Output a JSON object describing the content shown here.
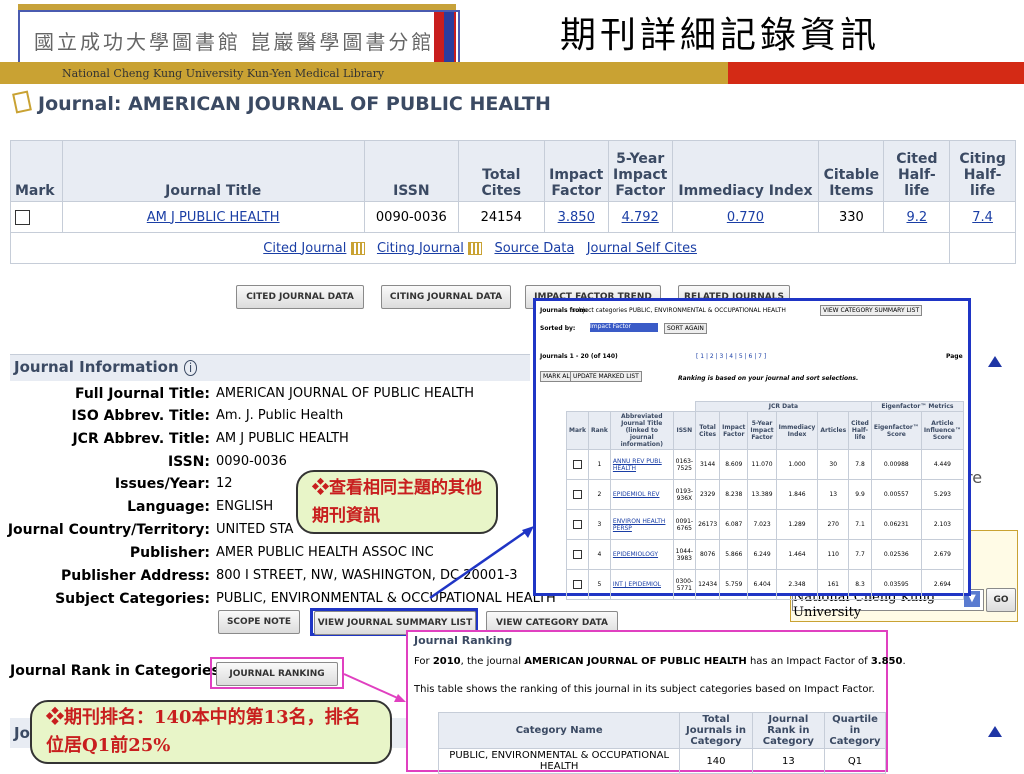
{
  "header": {
    "library_cn": "國立成功大學圖書館 崑巖醫學圖書分館",
    "library_en": "National Cheng Kung University Kun-Yen Medical Library",
    "slide_title": "期刊詳細記錄資訊"
  },
  "journal": {
    "heading": "Journal: AMERICAN JOURNAL OF PUBLIC HEALTH"
  },
  "main_table": {
    "headers": [
      "Mark",
      "Journal Title",
      "ISSN",
      "Total Cites",
      "Impact Factor",
      "5-Year Impact Factor",
      "Immediacy Index",
      "Citable Items",
      "Cited Half-life",
      "Citing Half-life"
    ],
    "row": {
      "title": "AM J PUBLIC HEALTH",
      "issn": "0090-0036",
      "total_cites": "24154",
      "impact_factor": "3.850",
      "five_year_if": "4.792",
      "immediacy": "0.770",
      "citable_items": "330",
      "cited_half_life": "9.2",
      "citing_half_life": "7.4"
    },
    "links": [
      "Cited Journal",
      "Citing Journal",
      "Source Data",
      "Journal Self Cites"
    ]
  },
  "buttons": {
    "cited_journal_data": "CITED JOURNAL DATA",
    "citing_journal_data": "CITING JOURNAL DATA",
    "impact_factor_trend": "IMPACT FACTOR TREND",
    "related_journals": "RELATED JOURNALS",
    "scope_note": "SCOPE NOTE",
    "view_journal_summary": "VIEW JOURNAL SUMMARY LIST",
    "view_category_data": "VIEW CATEGORY DATA",
    "journal_ranking": "JOURNAL RANKING",
    "go": "GO"
  },
  "info": {
    "section_title": "Journal Information",
    "rows": [
      {
        "label": "Full Journal Title:",
        "value": "AMERICAN JOURNAL OF PUBLIC HEALTH"
      },
      {
        "label": "ISO Abbrev. Title:",
        "value": "Am. J. Public Health"
      },
      {
        "label": "JCR Abbrev. Title:",
        "value": "AM J PUBLIC HEALTH"
      },
      {
        "label": "ISSN:",
        "value": "0090-0036"
      },
      {
        "label": "Issues/Year:",
        "value": "12"
      },
      {
        "label": "Language:",
        "value": "ENGLISH"
      },
      {
        "label": "Journal Country/Territory:",
        "value": "UNITED STA"
      },
      {
        "label": "Publisher:",
        "value": "AMER PUBLIC HEALTH ASSOC INC"
      },
      {
        "label": "Publisher Address:",
        "value": "800 I STREET, NW, WASHINGTON, DC 20001-3"
      },
      {
        "label": "Subject Categories:",
        "value": "PUBLIC, ENVIRONMENTAL & OCCUPATIONAL HEALTH"
      }
    ],
    "rank_label": "Journal Rank in Categories:",
    "next_section": "Jo",
    "eigen_fragment": "re",
    "institution_select": "National Cheng Kung University"
  },
  "callouts": {
    "topic": "❖查看相同主題的其他期刊資訊",
    "rank": "❖期刊排名：140本中的第13名，排名位居Q1前25%"
  },
  "overlay_summary": {
    "journals_from_label": "Journals from:",
    "journals_from_value": "subject categories PUBLIC, ENVIRONMENTAL & OCCUPATIONAL HEALTH",
    "view_category_btn": "VIEW CATEGORY SUMMARY LIST",
    "sorted_by_label": "Sorted by:",
    "sorted_by_value": "Impact Factor",
    "sort_again": "SORT AGAIN",
    "count": "Journals 1 - 20 (of 140)",
    "pager": "[ 1 | 2 | 3 | 4 | 5 | 6 | 7 ]",
    "page_label": "Page",
    "mark_all": "MARK ALL",
    "update_marked": "UPDATE MARKED LIST",
    "ranking_note": "Ranking is based on your journal and sort selections.",
    "jcr_group": "JCR Data",
    "eigen_group": "Eigenfactor™ Metrics",
    "headers": [
      "Mark",
      "Rank",
      "Abbreviated Journal Title (linked to journal information)",
      "ISSN",
      "Total Cites",
      "Impact Factor",
      "5-Year Impact Factor",
      "Immediacy Index",
      "Articles",
      "Cited Half-life",
      "Eigenfactor™ Score",
      "Article Influence™ Score"
    ],
    "rows": [
      {
        "rank": "1",
        "title": "ANNU REV PUBL HEALTH",
        "issn": "0163-7525",
        "cites": "3144",
        "if": "8.609",
        "if5": "11.070",
        "imm": "1.000",
        "art": "30",
        "chl": "7.8",
        "eig": "0.00988",
        "ai": "4.449"
      },
      {
        "rank": "2",
        "title": "EPIDEMIOL REV",
        "issn": "0193-936X",
        "cites": "2329",
        "if": "8.238",
        "if5": "13.389",
        "imm": "1.846",
        "art": "13",
        "chl": "9.9",
        "eig": "0.00557",
        "ai": "5.293"
      },
      {
        "rank": "3",
        "title": "ENVIRON HEALTH PERSP",
        "issn": "0091-6765",
        "cites": "26173",
        "if": "6.087",
        "if5": "7.023",
        "imm": "1.289",
        "art": "270",
        "chl": "7.1",
        "eig": "0.06231",
        "ai": "2.103"
      },
      {
        "rank": "4",
        "title": "EPIDEMIOLOGY",
        "issn": "1044-3983",
        "cites": "8076",
        "if": "5.866",
        "if5": "6.249",
        "imm": "1.464",
        "art": "110",
        "chl": "7.7",
        "eig": "0.02536",
        "ai": "2.679"
      },
      {
        "rank": "5",
        "title": "INT J EPIDEMIOL",
        "issn": "0300-5771",
        "cites": "12434",
        "if": "5.759",
        "if5": "6.404",
        "imm": "2.348",
        "art": "161",
        "chl": "8.3",
        "eig": "0.03595",
        "ai": "2.694"
      }
    ]
  },
  "overlay_ranking": {
    "title": "Journal Ranking",
    "sentence_prefix": "For",
    "year": "2010",
    "sentence_mid": ", the journal",
    "journal": "AMERICAN JOURNAL OF PUBLIC HEALTH",
    "sentence_suffix": "has an Impact Factor of",
    "impact_factor": "3.850",
    "table_note": "This table shows the ranking of this journal in its subject categories based on Impact Factor.",
    "headers": [
      "Category Name",
      "Total Journals in Category",
      "Journal Rank in Category",
      "Quartile in Category"
    ],
    "row": {
      "category": "PUBLIC, ENVIRONMENTAL & OCCUPATIONAL HEALTH",
      "total": "140",
      "rank": "13",
      "quartile": "Q1"
    }
  }
}
